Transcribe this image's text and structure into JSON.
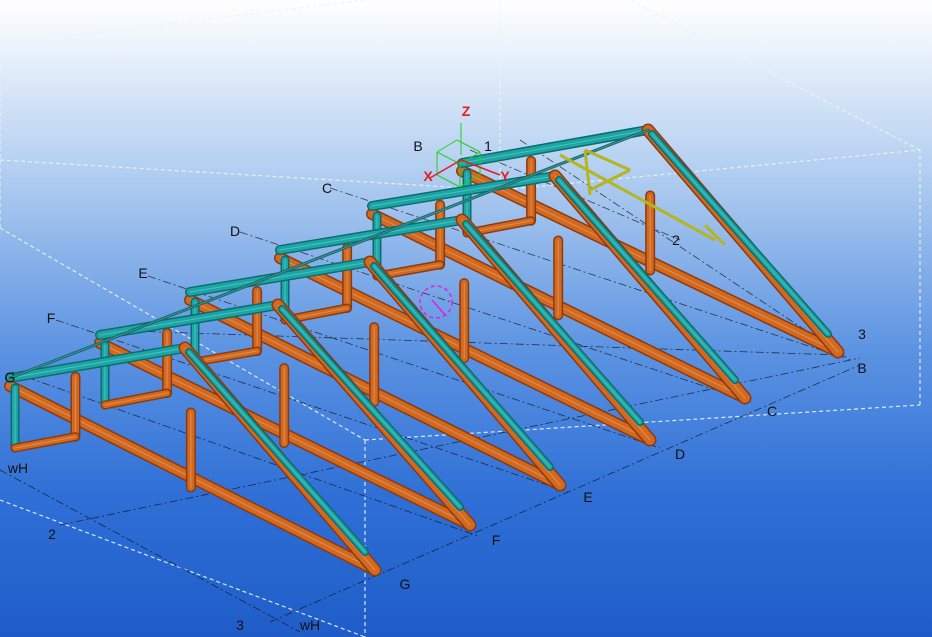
{
  "viewport": {
    "background": "blue-gradient-3d-view"
  },
  "colors": {
    "chord": "#d2691e",
    "chord_dark": "#8b3a10",
    "web": "#1aa6a6",
    "web_dark": "#0e6b6b",
    "bracing": "#b5b520",
    "workarea": "#e8f4ff",
    "gridline": "#111111",
    "axis_x": "#e02020",
    "axis_y": "#e02020",
    "axis_z": "#e02020",
    "gizmo": "#20d020",
    "marker": "#e020e0"
  },
  "axes": {
    "x": "X",
    "y": "Y",
    "z": "Z"
  },
  "grid_labels": {
    "top_b": "B",
    "top_1": "1",
    "top_c": "C",
    "top_d": "D",
    "top_e": "E",
    "top_f": "F",
    "top_g": "G",
    "left_wh": "wH",
    "left_2": "2",
    "bottom_3": "3",
    "bottom_wh": "wH",
    "right_2": "2",
    "right_3": "3",
    "right_b": "B",
    "right_c": "C",
    "right_d": "D",
    "right_e": "E",
    "right_f": "F",
    "right_g": "G"
  },
  "model": {
    "type": "roof-truss-frame",
    "truss_count": 6,
    "icons": [
      "coordinate-gizmo-icon",
      "rotation-center-icon"
    ]
  }
}
